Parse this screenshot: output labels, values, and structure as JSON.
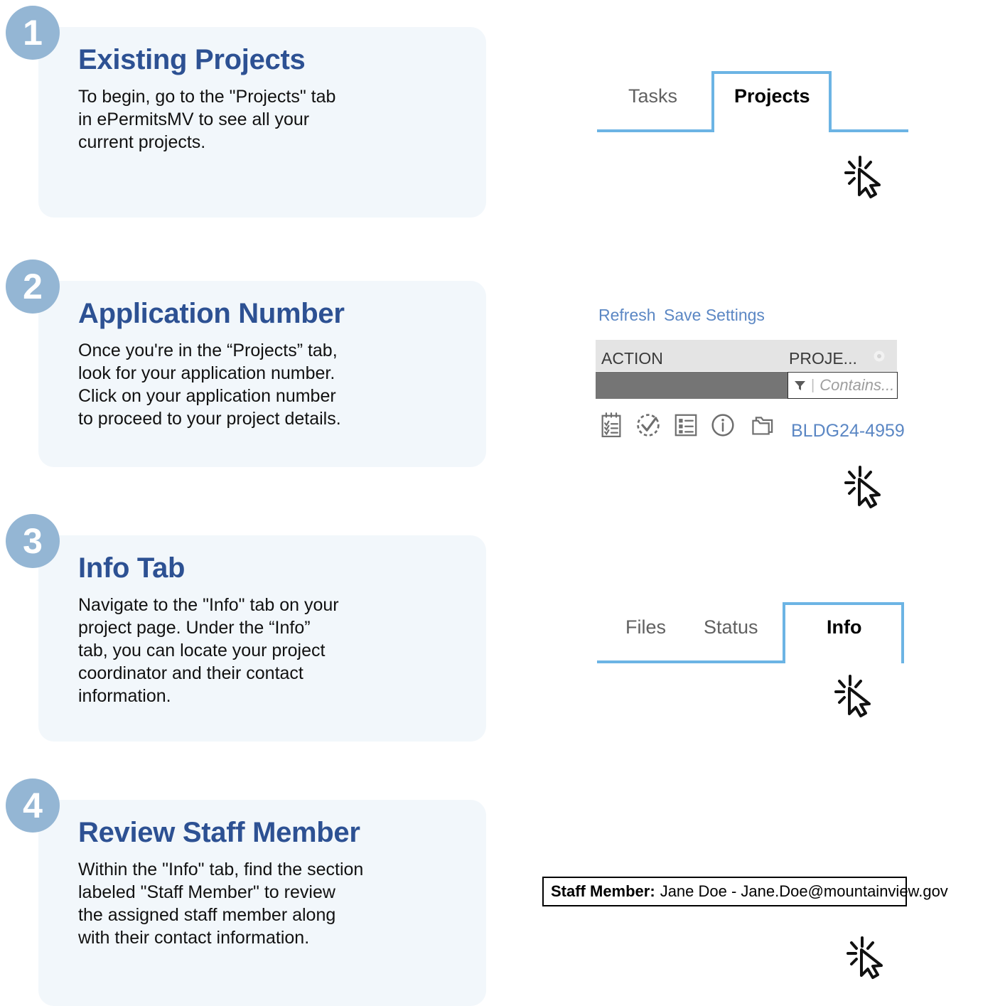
{
  "steps": [
    {
      "number": "1",
      "title": "Existing Projects",
      "body": "To begin, go to the \"Projects\" tab\nin ePermitsMV to see all your\ncurrent projects."
    },
    {
      "number": "2",
      "title": "Application Number",
      "body": "Once you're in the “Projects” tab,\nlook for your application number.\nClick on your application number\nto proceed to your project details."
    },
    {
      "number": "3",
      "title": "Info Tab",
      "body": "Navigate to the \"Info\" tab on your\nproject page. Under the “Info”\ntab, you can locate your project\ncoordinator and their contact\ninformation."
    },
    {
      "number": "4",
      "title": "Review Staff Member",
      "body": "Within the \"Info\" tab, find the section\nlabeled \"Staff Member\" to review\nthe assigned staff member along\nwith their contact information."
    }
  ],
  "visual_1": {
    "tabs": [
      {
        "label": "Tasks",
        "active": false
      },
      {
        "label": "Projects",
        "active": true
      }
    ],
    "cursor_icon": "click-cursor-icon"
  },
  "visual_2": {
    "toolbar": {
      "refresh_label": "Refresh",
      "save_settings_label": "Save Settings"
    },
    "grid_header": {
      "action_column": "ACTION",
      "project_column": "PROJE...",
      "settings_icon": "gear-icon"
    },
    "filter": {
      "funnel_icon": "funnel-icon",
      "divider": "|",
      "placeholder": "Contains..."
    },
    "row_icons": [
      "clipboard-checklist-icon",
      "check-circle-dashed-icon",
      "list-details-icon",
      "info-circle-icon",
      "folders-icon"
    ],
    "application_number": "BLDG24-4959",
    "cursor_icon": "click-cursor-icon"
  },
  "visual_3": {
    "tabs": [
      {
        "label": "Files",
        "active": false
      },
      {
        "label": "Status",
        "active": false
      },
      {
        "label": "Info",
        "active": true
      }
    ],
    "cursor_icon": "click-cursor-icon"
  },
  "visual_4": {
    "staff_member": {
      "label": "Staff Member:",
      "value": "Jane Doe - Jane.Doe@mountainview.gov"
    },
    "cursor_icon": "click-cursor-icon"
  },
  "colors": {
    "badge_blue": "#94b6d4",
    "card_background": "#f2f7fb",
    "title_navy": "#2d5193",
    "tab_accent": "#6cb4e4",
    "link_blue": "#5b87c4",
    "grid_header_gray": "#e4e4e4",
    "grid_filter_gray": "#757575"
  }
}
